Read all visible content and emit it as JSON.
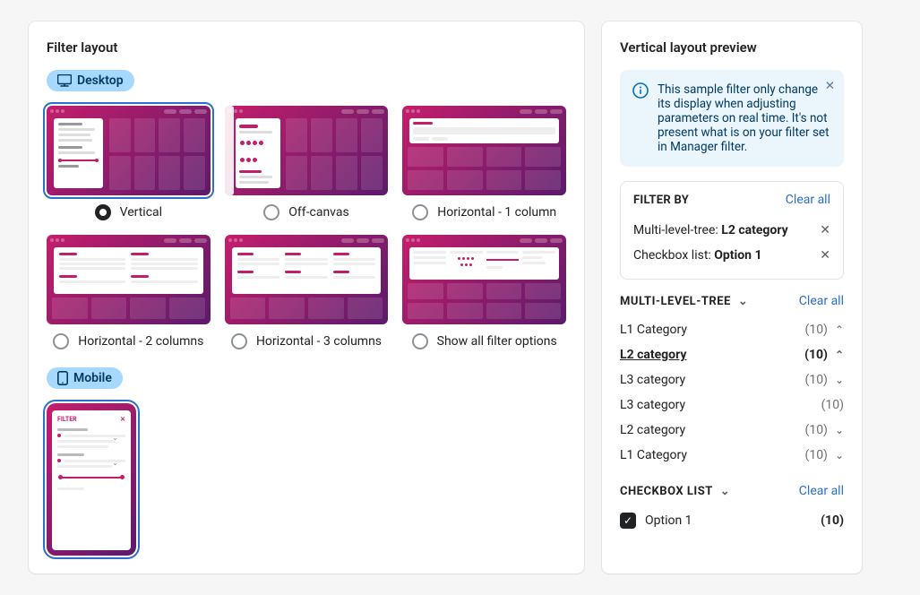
{
  "left": {
    "title": "Filter layout",
    "desktop_chip": "Desktop",
    "mobile_chip": "Mobile",
    "options": [
      {
        "id": "vertical",
        "label": "Vertical",
        "selected": true
      },
      {
        "id": "offcanvas",
        "label": "Off-canvas",
        "selected": false
      },
      {
        "id": "h1",
        "label": "Horizontal - 1 column",
        "selected": false
      },
      {
        "id": "h2",
        "label": "Horizontal - 2 columns",
        "selected": false
      },
      {
        "id": "h3",
        "label": "Horizontal - 3 columns",
        "selected": false
      },
      {
        "id": "show",
        "label": "Show all filter options",
        "selected": false
      }
    ],
    "mobile_title": "FILTER"
  },
  "right": {
    "title": "Vertical layout preview",
    "info": "This sample filter only change its display when adjusting parameters on real time. It's not present what is on your filter set in Manager filter.",
    "filter_by": {
      "title": "FILTER BY",
      "clear": "Clear all",
      "items": [
        {
          "prefix": "Multi-level-tree:",
          "value": "L2 category"
        },
        {
          "prefix": "Checkbox list:",
          "value": "Option 1"
        }
      ]
    },
    "tree": {
      "title": "MULTI-LEVEL-TREE",
      "clear": "Clear all",
      "rows": [
        {
          "name": "L1 Category",
          "count": "(10)",
          "pad": 0,
          "expanded": true,
          "hasChev": true
        },
        {
          "name": "L2 category",
          "count": "(10)",
          "pad": 1,
          "expanded": true,
          "bold": true,
          "underline": true,
          "hasChev": true
        },
        {
          "name": "L3 category",
          "count": "(10)",
          "pad": 2,
          "hasChev": true
        },
        {
          "name": "L3 category",
          "count": "(10)",
          "pad": 2,
          "hasChev": false
        },
        {
          "name": "L2 category",
          "count": "(10)",
          "pad": 1,
          "hasChev": true
        },
        {
          "name": "L1 Category",
          "count": "(10)",
          "pad": 0,
          "hasChev": true
        }
      ]
    },
    "checkbox": {
      "title": "CHECKBOX LIST",
      "clear": "Clear all",
      "rows": [
        {
          "label": "Option 1",
          "count": "(10)",
          "checked": true
        }
      ]
    }
  }
}
